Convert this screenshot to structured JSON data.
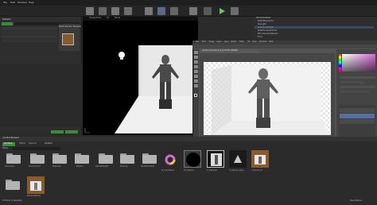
{
  "window": {
    "menu": [
      "File",
      "Edit",
      "Window",
      "Help"
    ]
  },
  "left_panel": {
    "title": "Details",
    "search_placeholder": "Search Details",
    "tabs": [
      "Place",
      "Modes"
    ],
    "rows": [
      "Actor",
      "Transform",
      "Static Mesh",
      "Materials",
      "Physics",
      "Collision",
      "Lighting",
      "Rendering"
    ]
  },
  "details_preview": {
    "label": "Mesh Render Preview"
  },
  "viewport": {
    "mode": "Perspective",
    "lit": "Lit",
    "show": "Show"
  },
  "outliner": {
    "title": "World Outliner",
    "items": [
      "StaticMeshActor",
      "SkyLight",
      "DirectionalLight",
      "PostProcessVolume",
      "BP_CharacterRender",
      "Floor"
    ]
  },
  "photoshop": {
    "menu": [
      "File",
      "Edit",
      "Image",
      "Layer",
      "Type",
      "Select",
      "Filter",
      "3D",
      "View",
      "Window",
      "Help"
    ],
    "doc_tab": "render-character.png @ 33.3% (RGB/8)"
  },
  "right_panel": {
    "labels": [
      "Color",
      "Swatches",
      "Properties",
      "Adjustments",
      "Layers",
      "Channels",
      "Paths"
    ]
  },
  "content_browser": {
    "title": "Content Browser",
    "add_new": "Add New",
    "import": "Import",
    "save_all": "Save All",
    "path": "Content",
    "filters": "Filters",
    "search_placeholder": "Search Content",
    "status": "12 items (1 selected)",
    "view_options": "View Options",
    "folders": [
      "Characters",
      "Environment",
      "Materials",
      "Meshes",
      "RenderTargets",
      "Textures",
      "StarterContent"
    ],
    "assets": [
      "M_ColorWheel",
      "RT_Capture",
      "T_Character",
      "T_Capture_Alpha",
      "T_Render_01",
      "RenderLighting"
    ]
  },
  "status_bar": {
    "text": "Ready"
  },
  "colors": {
    "ue_bg": "#2b2b2b",
    "panel": "#3a3a3a",
    "viewport_bg": "#000000",
    "ps_bg": "#535353",
    "accent_green": "#3c8a3c"
  }
}
